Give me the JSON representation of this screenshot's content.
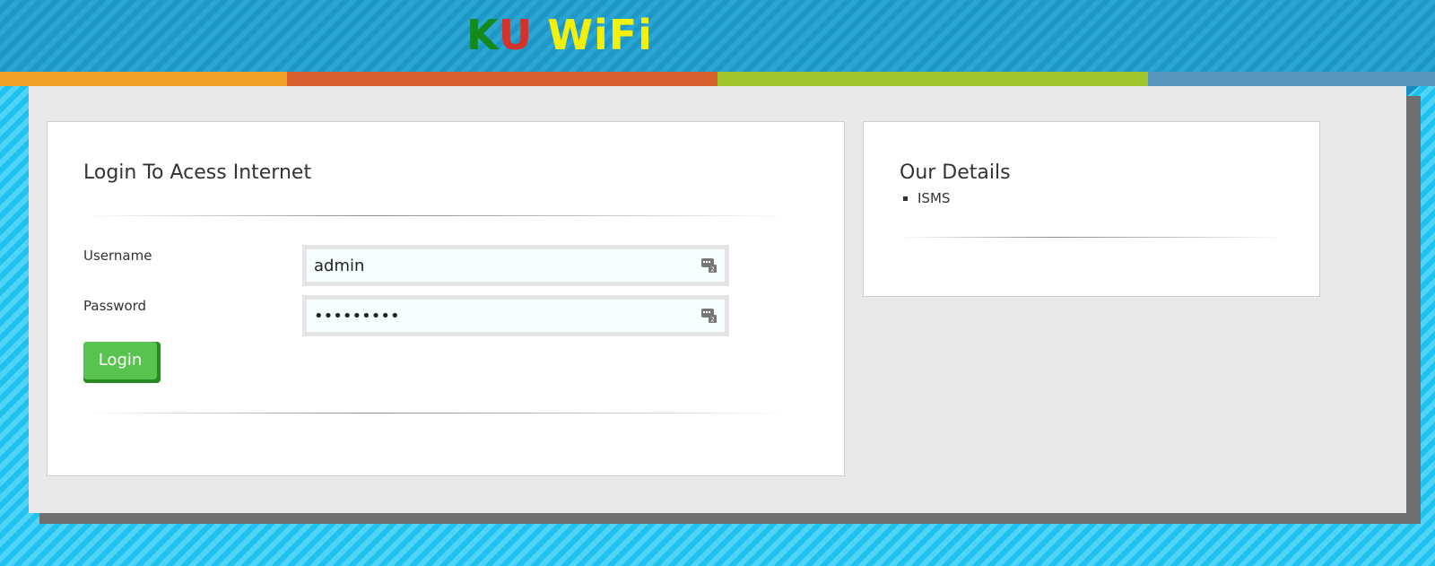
{
  "header": {
    "logo_text": "KU WiFi",
    "logo_parts": {
      "k": "K",
      "u": "U",
      "wifi": "WiFi"
    },
    "colors": {
      "k": "#138a1b",
      "u": "#d2342b",
      "wifi": "#f3f10b"
    }
  },
  "colorbar": [
    "#f2a12a",
    "#d85f30",
    "#a2c62d",
    "#5a95be"
  ],
  "login": {
    "title": "Login To Acess Internet",
    "username_label": "Username",
    "username_value": "admin",
    "password_label": "Password",
    "password_value": "•••••••••",
    "login_button": "Login"
  },
  "details": {
    "title": "Our Details",
    "items": [
      "ISMS"
    ]
  },
  "icons": {
    "keyboard": "keyboard-icon"
  }
}
